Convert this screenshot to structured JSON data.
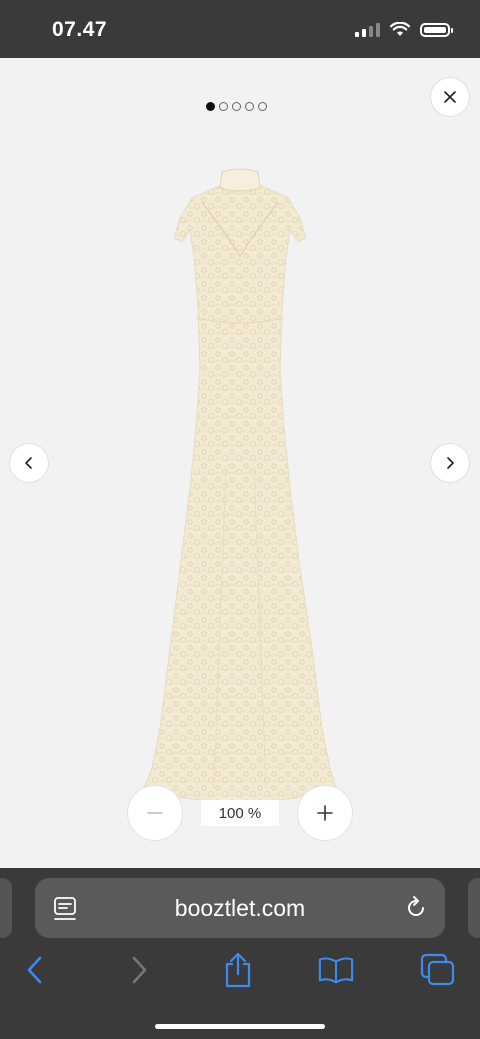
{
  "status_bar": {
    "time": "07.47"
  },
  "gallery": {
    "total_images": 5,
    "active_index": 0,
    "close_icon": "close-icon",
    "prev_icon": "chevron-left-icon",
    "next_icon": "chevron-right-icon"
  },
  "product_image": {
    "colors": {
      "dress": "#f3ead4",
      "lace": "#e6d8b8"
    }
  },
  "zoom": {
    "level_label": "100 %",
    "out_icon": "minus-icon",
    "in_icon": "plus-icon"
  },
  "browser": {
    "url": "booztlet.com",
    "page_menu_icon": "page-menu-icon",
    "reload_icon": "reload-icon",
    "toolbar": [
      "back-icon",
      "forward-icon",
      "share-icon",
      "bookmarks-icon",
      "tabs-icon"
    ],
    "accent": "#3d8bf0"
  }
}
